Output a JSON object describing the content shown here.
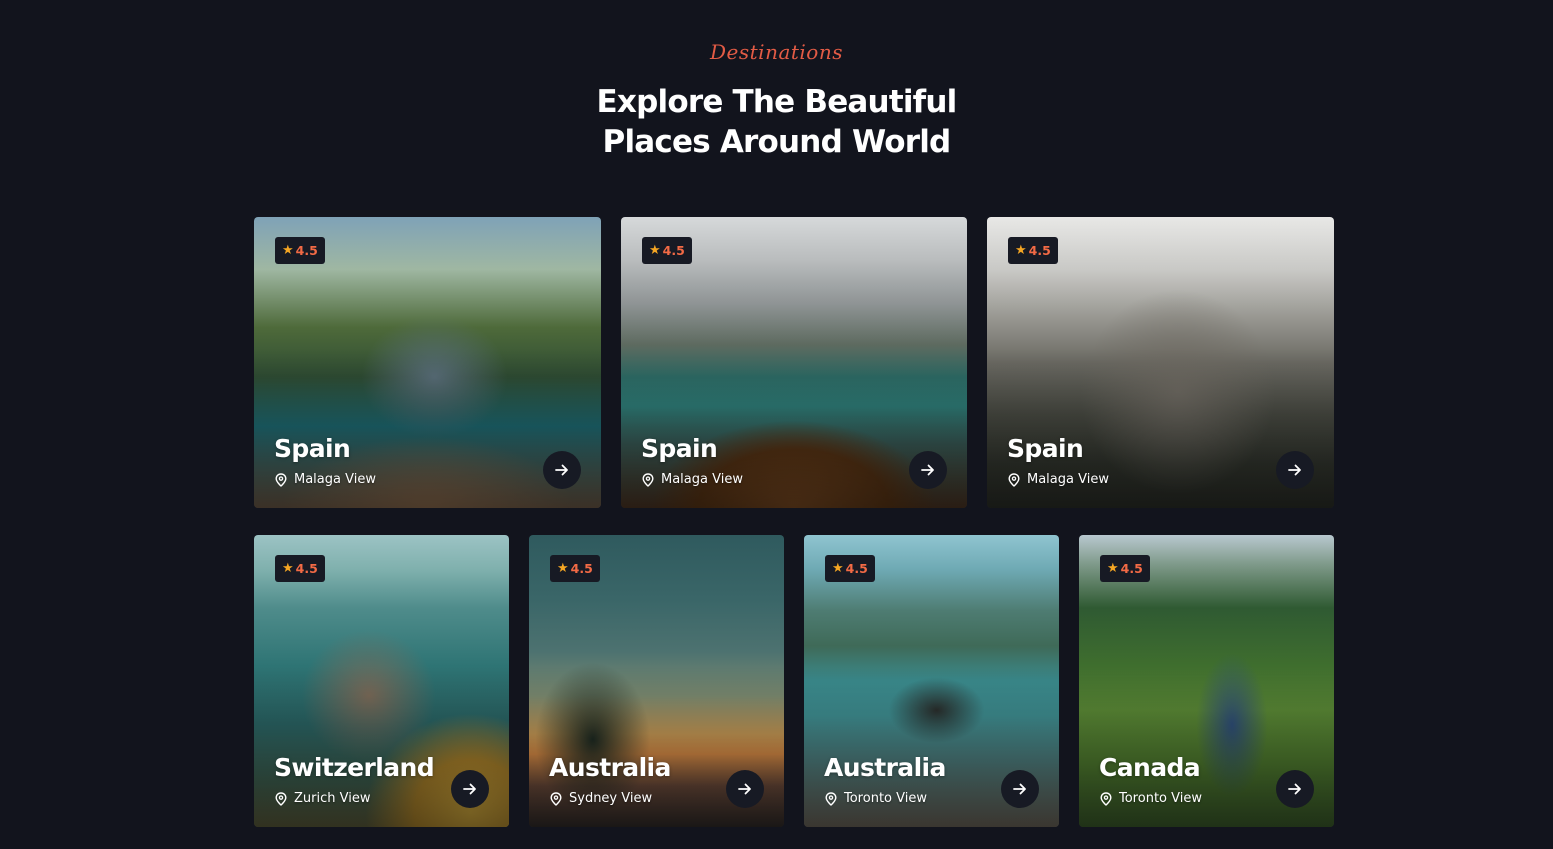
{
  "section": {
    "eyebrow": "Destinations",
    "title_line1": "Explore The Beautiful",
    "title_line2": "Places Around World"
  },
  "colors": {
    "background": "#12141d",
    "accent": "#e25b45",
    "badge_bg": "#171a24",
    "star": "#f5a623"
  },
  "destinations": [
    {
      "rating": "4.5",
      "name": "Spain",
      "location": "Malaga View",
      "scene": "woman on boat in tropical lagoon"
    },
    {
      "rating": "4.5",
      "name": "Spain",
      "location": "Malaga View",
      "scene": "boat bow on alpine lake"
    },
    {
      "rating": "4.5",
      "name": "Spain",
      "location": "Malaga View",
      "scene": "rocky mountain peaks under clouds"
    },
    {
      "rating": "4.5",
      "name": "Switzerland",
      "location": "Zurich View",
      "scene": "coastal cliff village"
    },
    {
      "rating": "4.5",
      "name": "Australia",
      "location": "Sydney View",
      "scene": "sunset with tree silhouette"
    },
    {
      "rating": "4.5",
      "name": "Australia",
      "location": "Toronto View",
      "scene": "kayaker on mountain lake"
    },
    {
      "rating": "4.5",
      "name": "Canada",
      "location": "Toronto View",
      "scene": "train through green hills"
    }
  ],
  "icons": {
    "rating": "star-icon",
    "location": "map-pin-icon",
    "action": "arrow-right-icon"
  }
}
